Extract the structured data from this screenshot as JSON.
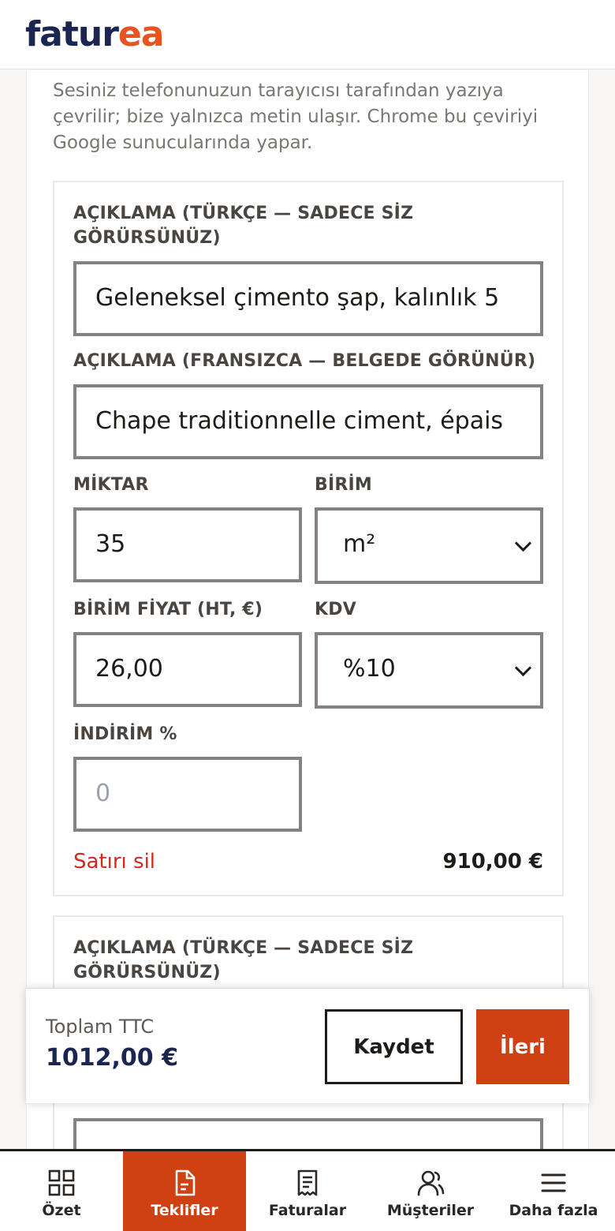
{
  "brand": {
    "logo_part1": "fatur",
    "logo_part2": "ea"
  },
  "hint": "Sesiniz telefonunuzun tarayıcısı tarafından yazıya çevrilir; bize yalnızca metin ulaşır. Chrome bu çeviriyi Google sunucularında yapar.",
  "line_item": {
    "desc_tr_label": "AÇIKLAMA (TÜRKÇE — SADECE SİZ GÖRÜRSÜNÜZ)",
    "desc_tr_value": "Geleneksel çimento şap, kalınlık 5",
    "desc_fr_label": "AÇIKLAMA (FRANSIZCA — BELGEDE GÖRÜNÜR)",
    "desc_fr_value": "Chape traditionnelle ciment, épais",
    "qty_label": "MİKTAR",
    "qty_value": "35",
    "unit_label": "BİRİM",
    "unit_value": "m²",
    "price_label": "BİRİM FİYAT (HT, €)",
    "price_value": "26,00",
    "vat_label": "KDV",
    "vat_value": "%10",
    "discount_label": "İNDİRİM %",
    "discount_placeholder": "0",
    "delete_label": "Satırı sil",
    "line_total": "910,00 €"
  },
  "line_item_2": {
    "desc_tr_label": "AÇIKLAMA (TÜRKÇE — SADECE SİZ GÖRÜRSÜNÜZ)"
  },
  "footer": {
    "total_label": "Toplam TTC",
    "total_value": "1012,00 €",
    "save_label": "Kaydet",
    "next_label": "İleri"
  },
  "nav": {
    "items": [
      {
        "label": "Özet",
        "icon": "grid-icon"
      },
      {
        "label": "Teklifler",
        "icon": "document-icon",
        "active": true
      },
      {
        "label": "Faturalar",
        "icon": "receipt-icon"
      },
      {
        "label": "Müşteriler",
        "icon": "users-icon"
      },
      {
        "label": "Daha fazla",
        "icon": "menu-icon"
      }
    ]
  },
  "colors": {
    "brand_navy": "#1a2552",
    "brand_orange": "#e8531f",
    "accent": "#cf4013",
    "danger": "#d12a1e"
  }
}
